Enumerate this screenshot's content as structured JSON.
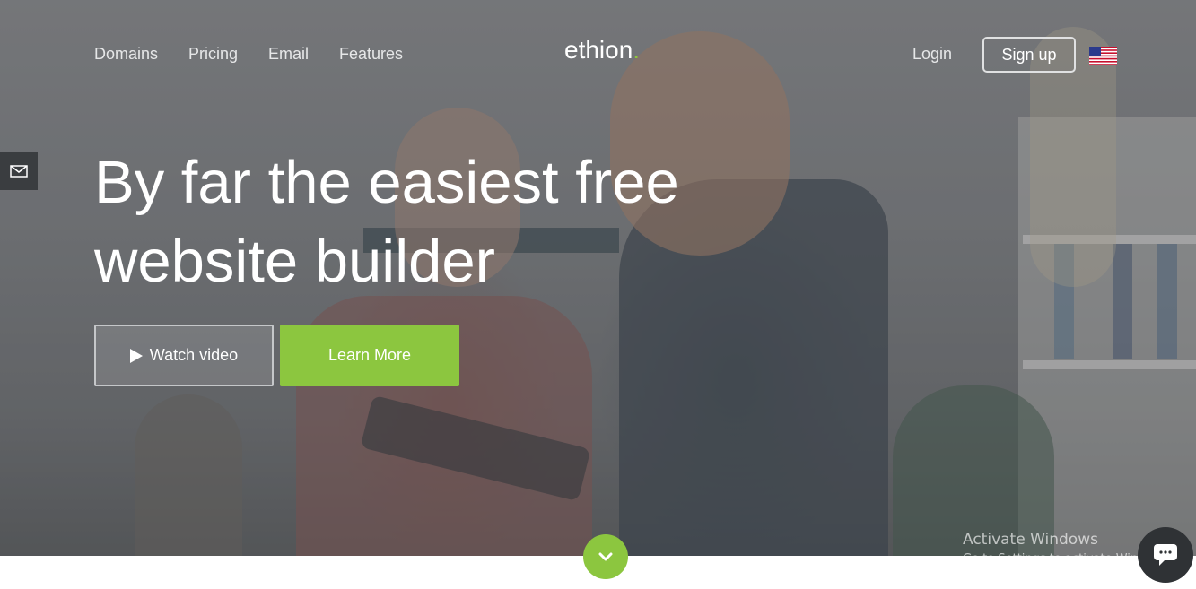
{
  "nav": {
    "links": [
      "Domains",
      "Pricing",
      "Email",
      "Features"
    ],
    "logo_text": "ethion",
    "logo_dot": ".",
    "login_label": "Login",
    "signup_label": "Sign up",
    "flag_icon": "us-flag-icon"
  },
  "side": {
    "icon": "mail-icon"
  },
  "hero": {
    "headline_line1": "By far the easiest free",
    "headline_line2": "website builder",
    "watch_video_label": "Watch video",
    "learn_more_label": "Learn More",
    "scroll_icon": "chevron-down-icon"
  },
  "os_watermark": {
    "title": "Activate Windows",
    "subtitle": "Go to Settings to activate Windows."
  },
  "chat": {
    "icon": "chat-icon"
  },
  "colors": {
    "accent": "#8cc63f",
    "text_light": "#e6e7e8",
    "dark_button": "#3a3d40"
  }
}
